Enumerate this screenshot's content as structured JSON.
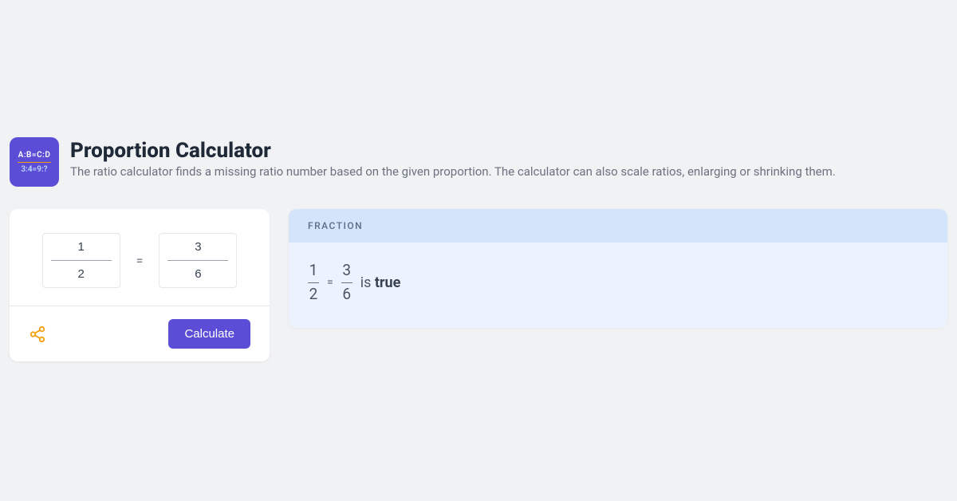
{
  "header": {
    "icon_line1": "A:B=C:D",
    "icon_line2": "3:4=9:?",
    "title": "Proportion Calculator",
    "subtitle": "The ratio calculator finds a missing ratio number based on the given proportion. The calculator can also scale ratios, enlarging or shrinking them."
  },
  "calculator": {
    "left_num": "1",
    "left_den": "2",
    "right_num": "3",
    "right_den": "6",
    "equals": "=",
    "calculate_label": "Calculate"
  },
  "result": {
    "header": "FRACTION",
    "f1_num": "1",
    "f1_den": "2",
    "eq": "=",
    "f2_num": "3",
    "f2_den": "6",
    "is_text": "is ",
    "truth": "true"
  }
}
